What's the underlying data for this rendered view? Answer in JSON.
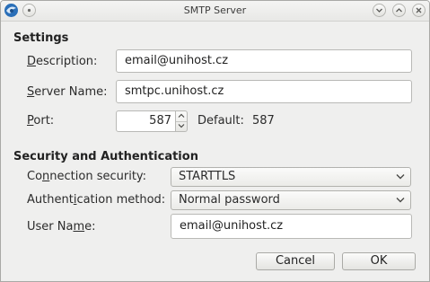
{
  "window": {
    "title": "SMTP Server"
  },
  "settings": {
    "heading": "Settings",
    "description": {
      "label_pre": "",
      "label_key": "D",
      "label_post": "escription:",
      "value": "email@unihost.cz"
    },
    "server_name": {
      "label_pre": "",
      "label_key": "S",
      "label_post": "erver Name:",
      "value": "smtpc.unihost.cz"
    },
    "port": {
      "label_pre": "",
      "label_key": "P",
      "label_post": "ort:",
      "value": "587",
      "default_label": "Default:",
      "default_value": "587"
    }
  },
  "security": {
    "heading": "Security and Authentication",
    "connection_security": {
      "label_pre": "Co",
      "label_key": "n",
      "label_post": "nection security:",
      "value": "STARTTLS"
    },
    "auth_method": {
      "label_pre": "Authent",
      "label_key": "i",
      "label_post": "cation method:",
      "value": "Normal password"
    },
    "user_name": {
      "label_pre": "User Na",
      "label_key": "m",
      "label_post": "e:",
      "value": "email@unihost.cz"
    }
  },
  "buttons": {
    "cancel": "Cancel",
    "ok": "OK"
  },
  "icons": {
    "app": "thunderbird-logo-icon",
    "pin": "pin-icon",
    "minimize": "minimize-icon",
    "maximize": "maximize-icon",
    "close": "close-icon",
    "spin_up": "chevron-up-icon",
    "spin_down": "chevron-down-icon",
    "dropdown": "chevron-down-icon"
  }
}
